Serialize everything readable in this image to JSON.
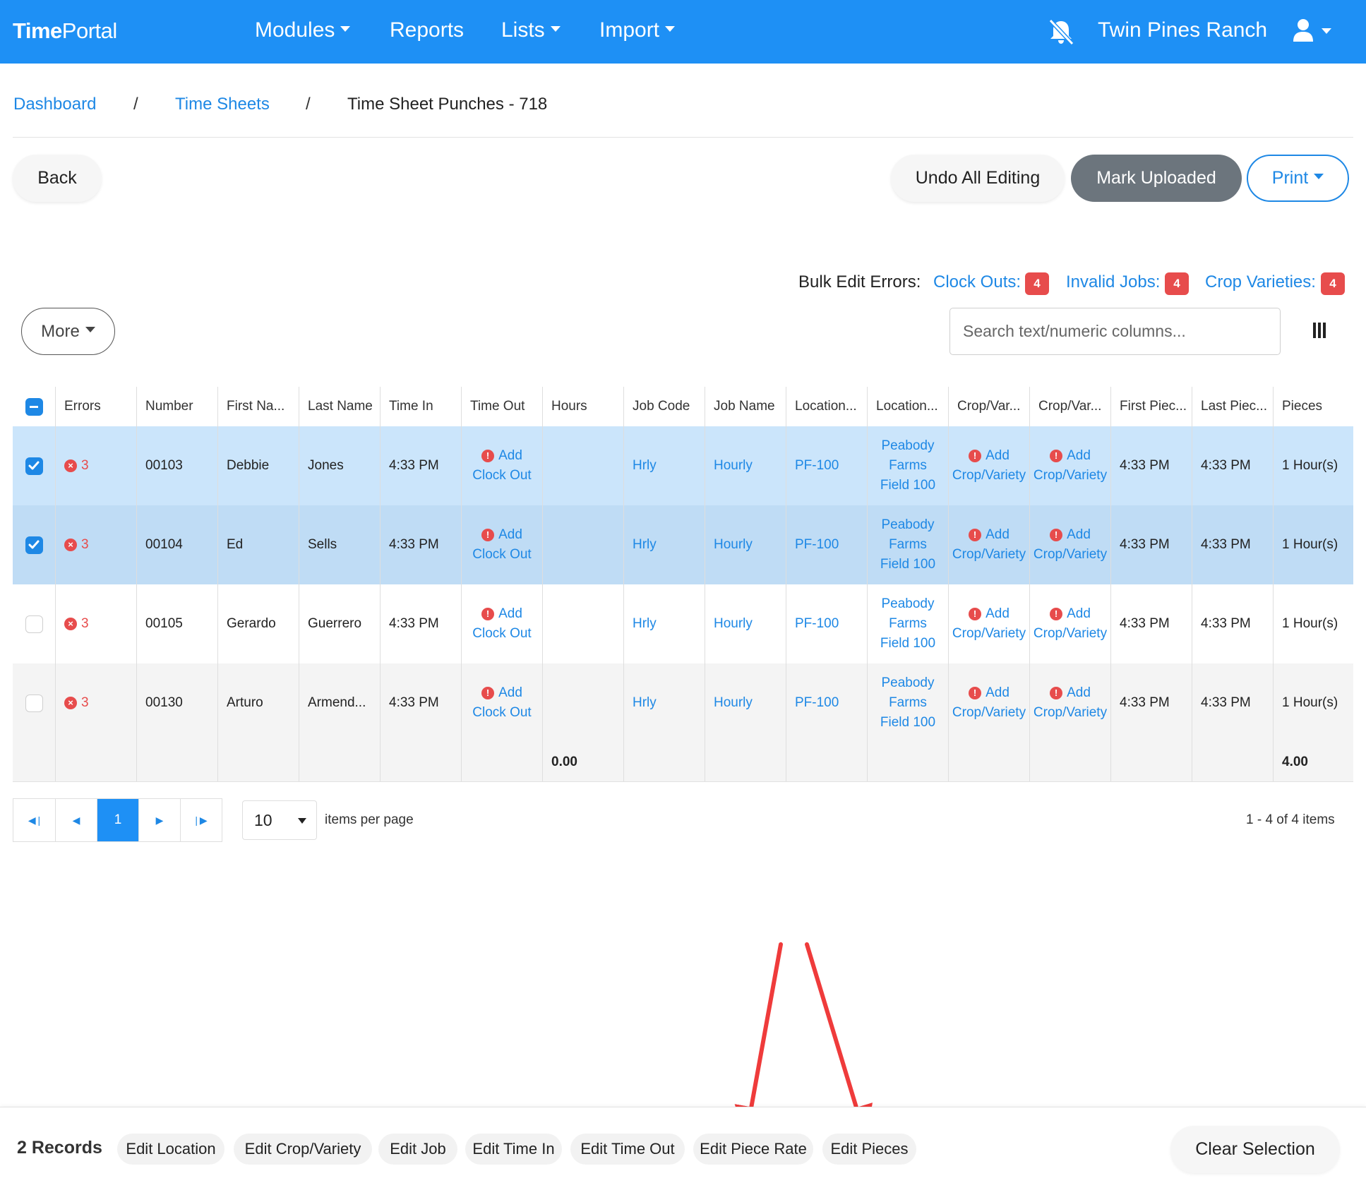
{
  "nav": {
    "brand_bold": "Time",
    "brand_rest": "Portal",
    "modules": "Modules",
    "reports": "Reports",
    "lists": "Lists",
    "import": "Import",
    "company": "Twin Pines Ranch"
  },
  "breadcrumb": {
    "dashboard": "Dashboard",
    "sep": "/",
    "timesheets": "Time Sheets",
    "current": "Time Sheet Punches - 718"
  },
  "actions": {
    "back": "Back",
    "undo": "Undo All Editing",
    "mark_uploaded": "Mark Uploaded",
    "print": "Print"
  },
  "bulk": {
    "label": "Bulk Edit Errors:",
    "clock_outs": "Clock Outs:",
    "clock_outs_count": "4",
    "invalid_jobs": "Invalid Jobs:",
    "invalid_jobs_count": "4",
    "crop_varieties": "Crop Varieties:",
    "crop_varieties_count": "4"
  },
  "toolbar": {
    "more": "More",
    "search_placeholder": "Search text/numeric columns..."
  },
  "columns": [
    "Errors",
    "Number",
    "First Na...",
    "Last Name",
    "Time In",
    "Time Out",
    "Hours",
    "Job Code",
    "Job Name",
    "Location...",
    "Location...",
    "Crop/Var...",
    "Crop/Var...",
    "First Piec...",
    "Last Piec...",
    "Pieces"
  ],
  "rows": [
    {
      "errors": "3",
      "number": "00103",
      "first": "Debbie",
      "last": "Jones",
      "time_in": "4:33 PM",
      "time_out_1": "Add",
      "time_out_2": "Clock Out",
      "hours": "",
      "job_code": "Hrly",
      "job_name": "Hourly",
      "loc_code": "PF-100",
      "loc_1": "Peabody",
      "loc_2": "Farms",
      "loc_3": "Field 100",
      "crop_a1": "Add",
      "crop_a2": "Crop/Variety",
      "crop_b1": "Add",
      "crop_b2": "Crop/Variety",
      "first_piece": "4:33 PM",
      "last_piece": "4:33 PM",
      "pieces": "1 Hour(s)",
      "selected": true
    },
    {
      "errors": "3",
      "number": "00104",
      "first": "Ed",
      "last": "Sells",
      "time_in": "4:33 PM",
      "time_out_1": "Add",
      "time_out_2": "Clock Out",
      "hours": "",
      "job_code": "Hrly",
      "job_name": "Hourly",
      "loc_code": "PF-100",
      "loc_1": "Peabody",
      "loc_2": "Farms",
      "loc_3": "Field 100",
      "crop_a1": "Add",
      "crop_a2": "Crop/Variety",
      "crop_b1": "Add",
      "crop_b2": "Crop/Variety",
      "first_piece": "4:33 PM",
      "last_piece": "4:33 PM",
      "pieces": "1 Hour(s)",
      "selected": true
    },
    {
      "errors": "3",
      "number": "00105",
      "first": "Gerardo",
      "last": "Guerrero",
      "time_in": "4:33 PM",
      "time_out_1": "Add",
      "time_out_2": "Clock Out",
      "hours": "",
      "job_code": "Hrly",
      "job_name": "Hourly",
      "loc_code": "PF-100",
      "loc_1": "Peabody",
      "loc_2": "Farms",
      "loc_3": "Field 100",
      "crop_a1": "Add",
      "crop_a2": "Crop/Variety",
      "crop_b1": "Add",
      "crop_b2": "Crop/Variety",
      "first_piece": "4:33 PM",
      "last_piece": "4:33 PM",
      "pieces": "1 Hour(s)",
      "selected": false
    },
    {
      "errors": "3",
      "number": "00130",
      "first": "Arturo",
      "last": "Armend...",
      "time_in": "4:33 PM",
      "time_out_1": "Add",
      "time_out_2": "Clock Out",
      "hours": "",
      "job_code": "Hrly",
      "job_name": "Hourly",
      "loc_code": "PF-100",
      "loc_1": "Peabody",
      "loc_2": "Farms",
      "loc_3": "Field 100",
      "crop_a1": "Add",
      "crop_a2": "Crop/Variety",
      "crop_b1": "Add",
      "crop_b2": "Crop/Variety",
      "first_piece": "4:33 PM",
      "last_piece": "4:33 PM",
      "pieces": "1 Hour(s)",
      "selected": false
    }
  ],
  "footer": {
    "hours_total": "0.00",
    "pieces_total": "4.00"
  },
  "pager": {
    "current_page": "1",
    "page_size": "10",
    "items_per_page": "items per page",
    "summary": "1 - 4 of 4 items"
  },
  "bottom_bar": {
    "records": "2 Records",
    "edit_location": "Edit Location",
    "edit_crop": "Edit Crop/Variety",
    "edit_job": "Edit Job",
    "edit_time_in": "Edit Time In",
    "edit_time_out": "Edit Time Out",
    "edit_piece_rate": "Edit Piece Rate",
    "edit_pieces": "Edit Pieces",
    "clear_selection": "Clear Selection"
  },
  "colors": {
    "brand_blue": "#1e90f5",
    "link_blue": "#1e88e5",
    "error_red": "#e74c4c",
    "selected_row": "#cbe5fb",
    "annotation_arrow": "#ef3b3b"
  },
  "icons": [
    "bell-off-icon",
    "user-icon",
    "column-chooser-icon",
    "error-x-icon",
    "alert-circle-icon",
    "first-page-icon",
    "prev-page-icon",
    "next-page-icon",
    "last-page-icon"
  ]
}
